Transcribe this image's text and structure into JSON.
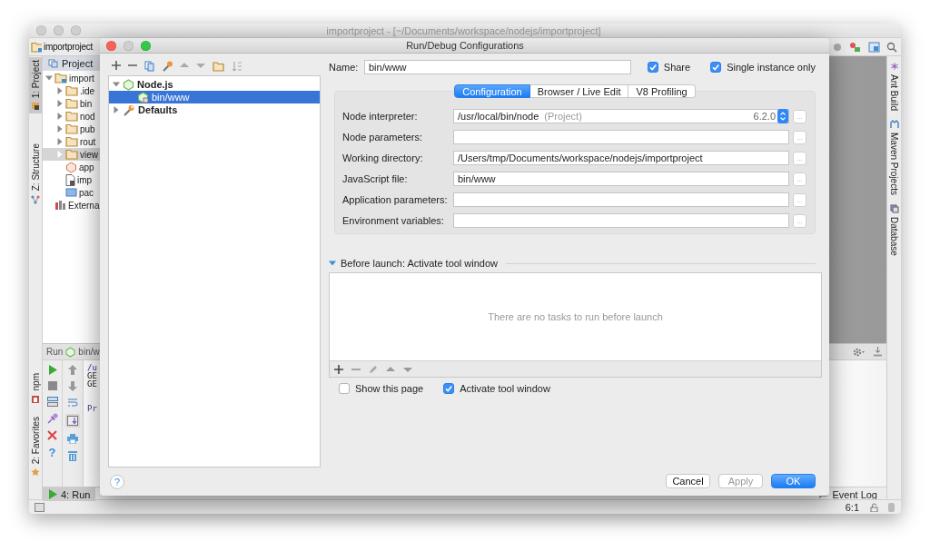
{
  "ide": {
    "title": "importproject - [~/Documents/workspace/nodejs/importproject]",
    "breadcrumb": "importproject",
    "left_tabs_top": [
      {
        "label": "1: Project",
        "selected": true
      },
      {
        "label": "Z: Structure",
        "selected": false
      }
    ],
    "left_tabs_bottom": [
      {
        "label": "npm",
        "selected": false
      },
      {
        "label": "2: Favorites",
        "selected": false
      }
    ],
    "project_panel": {
      "title": "Project"
    },
    "project_tree": [
      {
        "label": "import",
        "kind": "project",
        "expanded": true,
        "selected": false,
        "children": [
          {
            "label": ".ide",
            "kind": "folder",
            "expanded": false,
            "selected": false
          },
          {
            "label": "bin",
            "kind": "folder",
            "expanded": false,
            "selected": false
          },
          {
            "label": "nod",
            "kind": "folder",
            "expanded": false,
            "selected": false
          },
          {
            "label": "pub",
            "kind": "folder",
            "expanded": false,
            "selected": false
          },
          {
            "label": "rout",
            "kind": "folder",
            "expanded": false,
            "selected": false
          },
          {
            "label": "view",
            "kind": "folder",
            "expanded": false,
            "selected": true
          },
          {
            "label": "app",
            "kind": "js",
            "selected": false
          },
          {
            "label": "imp",
            "kind": "file",
            "selected": false
          },
          {
            "label": "pac",
            "kind": "json",
            "selected": false
          }
        ]
      },
      {
        "label": "Externa",
        "kind": "library",
        "selected": false
      }
    ],
    "right_tabs": [
      {
        "label": "Ant Build",
        "kind": "ant"
      },
      {
        "label": "Maven Projects",
        "kind": "maven"
      },
      {
        "label": "Database",
        "kind": "database"
      }
    ],
    "run_panel": {
      "title": "Run",
      "config": "bin/w",
      "help": "?",
      "console": [
        {
          "text": "/u",
          "kind": "path"
        },
        {
          "text": "GE",
          "kind": "plain"
        },
        {
          "text": "GE",
          "kind": "plain"
        },
        {
          "text": "Pr",
          "kind": "prompt"
        }
      ]
    },
    "bottom_tabs": [
      {
        "label": "4: Run",
        "selected": true
      }
    ],
    "event_log": "Event Log",
    "status_bar": {
      "position": "6:1"
    }
  },
  "dialog": {
    "title": "Run/Debug Configurations",
    "tree": [
      {
        "label": "Node.js",
        "kind": "nodejs",
        "expanded": true,
        "selected": false,
        "children": [
          {
            "label": "bin/www",
            "kind": "nodefile",
            "selected": true
          }
        ]
      },
      {
        "label": "Defaults",
        "kind": "defaults",
        "expanded": false,
        "selected": false
      }
    ],
    "name_field": {
      "label": "Name:",
      "value": "bin/www"
    },
    "options": [
      {
        "label": "Share",
        "checked": true
      },
      {
        "label": "Single instance only",
        "checked": true
      }
    ],
    "tabs": [
      {
        "label": "Configuration",
        "selected": true
      },
      {
        "label": "Browser / Live Edit",
        "selected": false
      },
      {
        "label": "V8 Profiling",
        "selected": false
      }
    ],
    "fields": [
      {
        "label": "Node interpreter:",
        "kind": "interpreter",
        "value": "/usr/local/bin/node",
        "hint": "(Project)",
        "version": "6.2.0",
        "browse": "..."
      },
      {
        "label": "Node parameters:",
        "kind": "text",
        "browse": "..."
      },
      {
        "label": "Working directory:",
        "kind": "text",
        "value": "/Users/tmp/Documents/workspace/nodejs/importproject",
        "browse": "..."
      },
      {
        "label": "JavaScript file:",
        "kind": "text",
        "value": "bin/www",
        "browse": "..."
      },
      {
        "label": "Application parameters:",
        "kind": "text",
        "browse": "..."
      },
      {
        "label": "Environment variables:",
        "kind": "text",
        "browse": "..."
      }
    ],
    "before_launch": {
      "title": "Before launch: Activate tool window",
      "expanded": true,
      "empty_text": "There are no tasks to run before launch"
    },
    "launch_options": [
      {
        "label": "Show this page",
        "checked": false
      },
      {
        "label": "Activate tool window",
        "checked": true
      }
    ],
    "help": "?",
    "buttons": [
      {
        "label": "Cancel",
        "kind": "secondary",
        "disabled": false
      },
      {
        "label": "Apply",
        "kind": "secondary",
        "disabled": true
      },
      {
        "label": "OK",
        "kind": "primary",
        "disabled": false
      }
    ]
  }
}
